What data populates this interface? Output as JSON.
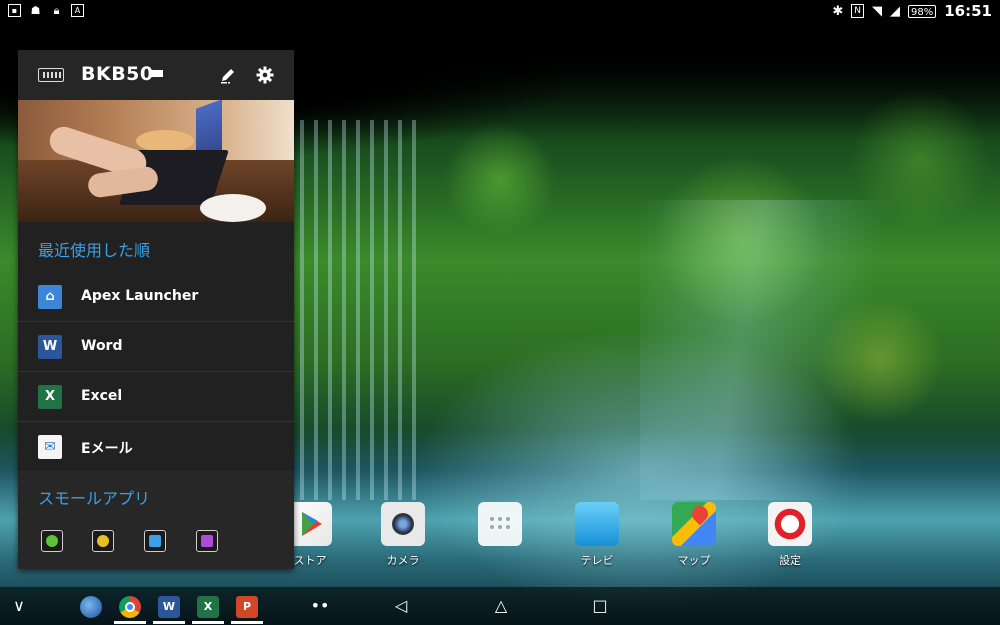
{
  "status_bar": {
    "left_icons": [
      "image-icon",
      "android-icon",
      "lock-icon",
      "a-icon"
    ],
    "battery": "98%",
    "time": "16:51"
  },
  "keyboard_panel": {
    "title": "BKB50",
    "recent_heading": "最近使用した順",
    "recent_apps": [
      {
        "label": "Apex Launcher",
        "icon": "apex-launcher-icon"
      },
      {
        "label": "Word",
        "icon": "word-icon"
      },
      {
        "label": "Excel",
        "icon": "excel-icon"
      },
      {
        "label": "Eメール",
        "icon": "email-icon"
      }
    ],
    "small_apps_heading": "スモールアプリ",
    "small_apps": [
      "small-app-green-icon",
      "small-app-yellow-icon",
      "small-app-calculator-icon",
      "small-app-purple-icon"
    ]
  },
  "dock": [
    {
      "label": "ストア",
      "icon": "play-store-icon"
    },
    {
      "label": "カメラ",
      "icon": "camera-icon"
    },
    {
      "label": "",
      "icon": "app-drawer-icon"
    },
    {
      "label": "テレビ",
      "icon": "tv-icon"
    },
    {
      "label": "マップ",
      "icon": "maps-icon"
    },
    {
      "label": "設定",
      "icon": "settings-icon"
    }
  ],
  "nav_bar": {
    "collapse": "∨",
    "more": "••",
    "back": "◁",
    "home": "△",
    "recents": "□"
  },
  "taskbar_apps": [
    {
      "icon": "browser-globe-icon",
      "text": ""
    },
    {
      "icon": "chrome-icon",
      "text": ""
    },
    {
      "icon": "word-icon",
      "text": "W"
    },
    {
      "icon": "excel-icon",
      "text": "X"
    },
    {
      "icon": "powerpoint-icon",
      "text": "P"
    }
  ],
  "colors": {
    "accent": "#3aa0e8",
    "panel_bg": "#212121",
    "word": "#2b579a",
    "excel": "#217346",
    "powerpoint": "#d24726"
  }
}
